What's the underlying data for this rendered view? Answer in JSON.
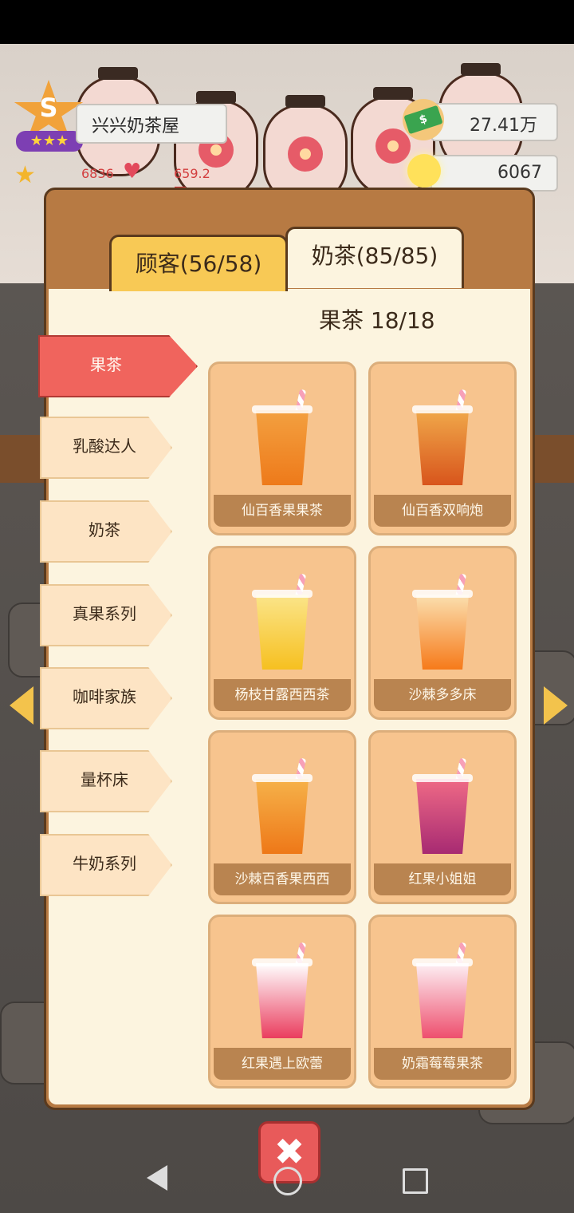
{
  "hud": {
    "shop_rank": "S",
    "shop_name": "兴兴奶茶屋",
    "stars": "6836",
    "likes": "659.2万",
    "money": "27.41万",
    "ideas": "6067"
  },
  "tabs": [
    {
      "label": "顾客(56/58)"
    },
    {
      "label": "奶茶(85/85)"
    }
  ],
  "section": {
    "title": "果茶 18/18"
  },
  "categories": [
    {
      "label": "果茶"
    },
    {
      "label": "乳酸达人"
    },
    {
      "label": "奶茶"
    },
    {
      "label": "真果系列"
    },
    {
      "label": "咖啡家族"
    },
    {
      "label": "量杯床"
    },
    {
      "label": "牛奶系列"
    }
  ],
  "drinks": [
    {
      "name": "仙百香果果茶",
      "top": "#f3a040",
      "bottom": "#ee7a1a"
    },
    {
      "name": "仙百香双响炮",
      "top": "#f0a84a",
      "bottom": "#d8551c"
    },
    {
      "name": "杨枝甘露西西茶",
      "top": "#fbe58a",
      "bottom": "#f6c020"
    },
    {
      "name": "沙棘多多床",
      "top": "#fbe0b0",
      "bottom": "#f67a1a"
    },
    {
      "name": "沙棘百香果西西",
      "top": "#f6b24a",
      "bottom": "#ee7818"
    },
    {
      "name": "红果小姐姐",
      "top": "#ef6a86",
      "bottom": "#a72a72"
    },
    {
      "name": "红果遇上欧蕾",
      "top": "#ffffff",
      "bottom": "#ea3d5e"
    },
    {
      "name": "奶霜莓莓果茶",
      "top": "#fdf0f4",
      "bottom": "#ee4f6e"
    }
  ],
  "close_label": "✖"
}
